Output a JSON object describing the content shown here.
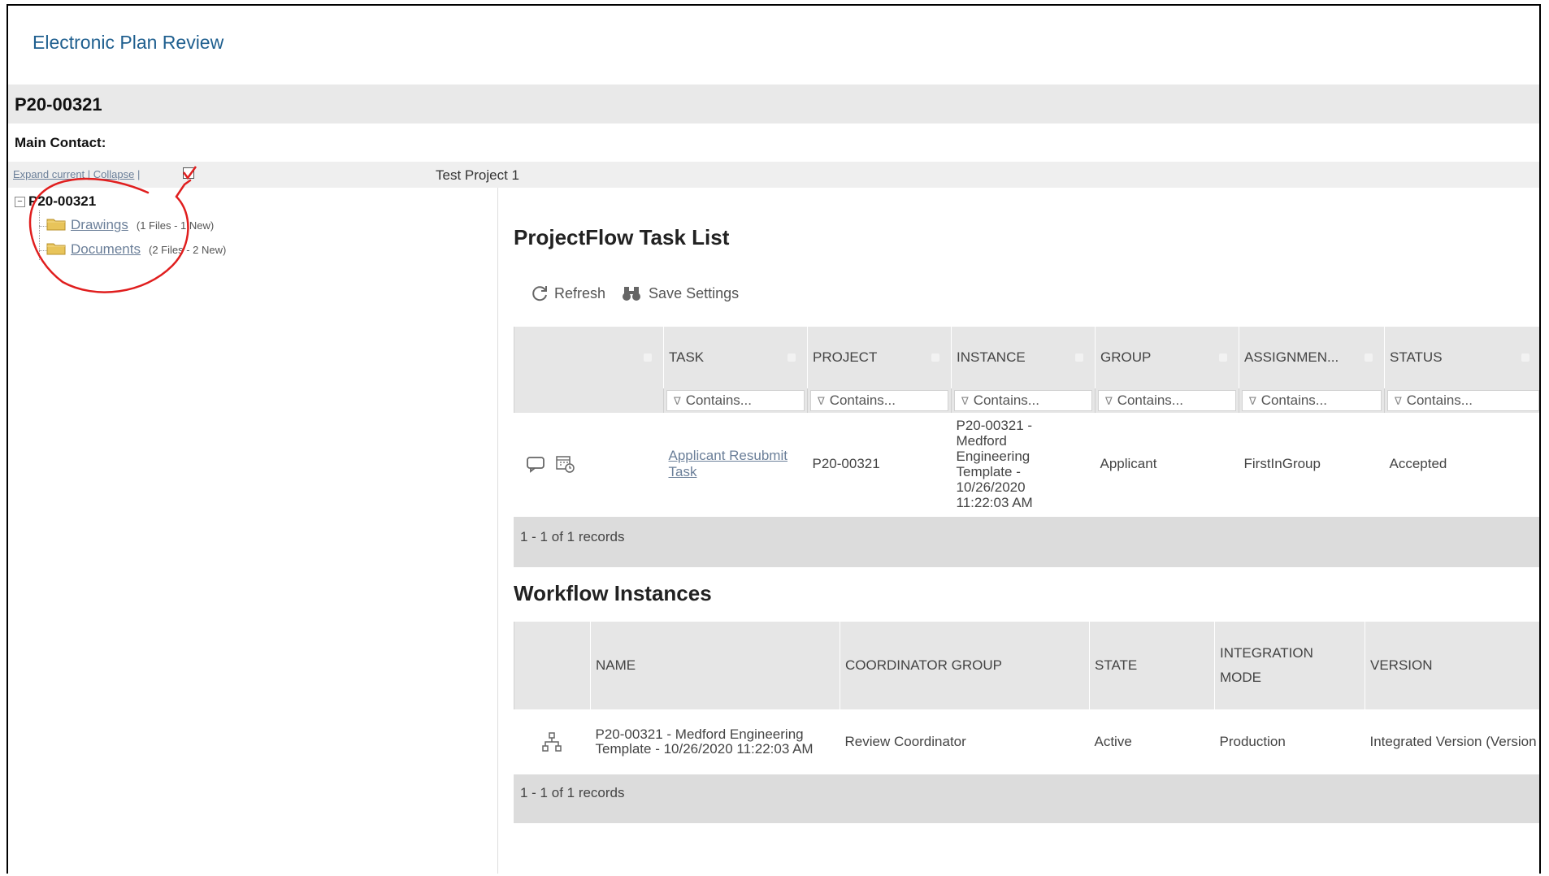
{
  "app": {
    "title": "Electronic Plan Review"
  },
  "record": {
    "id": "P20-00321",
    "main_contact_label": "Main Contact:"
  },
  "tree_toolbar": {
    "expand_label": "Expand current",
    "separator": " | ",
    "collapse_label": "Collapse",
    "trailing_separator": " |",
    "project_name": "Test Project 1"
  },
  "tree": {
    "root": "P20-00321",
    "toggle_symbol": "−",
    "items": [
      {
        "label": "Drawings",
        "meta": "(1 Files - 1 New)"
      },
      {
        "label": "Documents",
        "meta": "(2 Files - 2 New)"
      }
    ]
  },
  "task_list": {
    "title": "ProjectFlow Task List",
    "toolbar": {
      "refresh_label": "Refresh",
      "save_label": "Save Settings"
    },
    "columns": [
      "TASK",
      "PROJECT",
      "INSTANCE",
      "GROUP",
      "ASSIGNMEN...",
      "STATUS"
    ],
    "filter_placeholder": "Contains...",
    "filter_icon": "∇",
    "rows": [
      {
        "task": "Applicant Resubmit Task",
        "project": "P20-00321",
        "instance": "P20-00321 - Medford Engineering Template - 10/26/2020 11:22:03 AM",
        "group": "Applicant",
        "assignment": "FirstInGroup",
        "status": "Accepted"
      }
    ],
    "pager": "1 - 1 of 1 records"
  },
  "workflow": {
    "title": "Workflow Instances",
    "columns": [
      "NAME",
      "COORDINATOR GROUP",
      "STATE",
      "INTEGRATION MODE",
      "VERSION"
    ],
    "rows": [
      {
        "name": "P20-00321 - Medford Engineering Template - 10/26/2020 11:22:03 AM",
        "coordinator_group": "Review Coordinator",
        "state": "Active",
        "integration_mode": "Production",
        "version": "Integrated Version (Version"
      }
    ],
    "pager": "1 - 1 of 1 records"
  },
  "colors": {
    "accent": "#1f5f8f",
    "link": "#6b7f99",
    "annotation": "#e01e1e"
  }
}
